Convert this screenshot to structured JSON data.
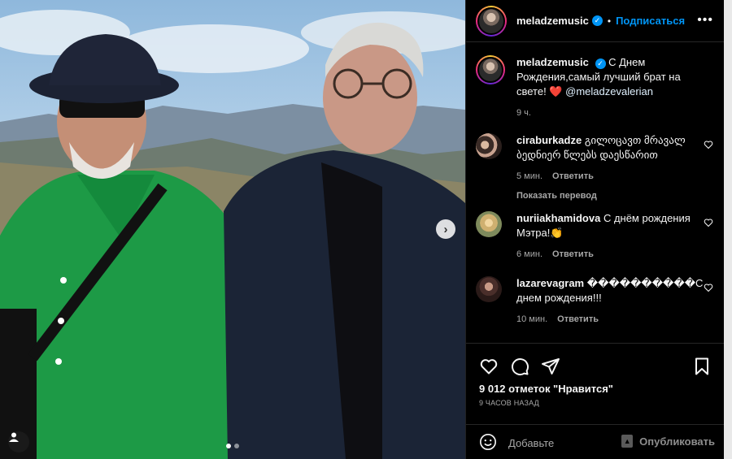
{
  "post": {
    "username": "meladzemusic",
    "follow_label": "Подписаться",
    "more_label": "•••",
    "next_label": "›"
  },
  "caption": {
    "username": "meladzemusic",
    "text": "С Днем Рождения,самый лучший брат на свете!",
    "emoji": "❤️",
    "mention": "@meladzevalerian",
    "time": "9 ч."
  },
  "comments": [
    {
      "username": "ciraburkadze",
      "text": "გილოცავთ მრავალ ბედნიერ წლებს დაესწარით",
      "time": "5 мин.",
      "reply_label": "Ответить",
      "translate_label": "Показать перевод"
    },
    {
      "username": "nuriiakhamidova",
      "text": "С днём рождения Мэтра!👏",
      "time": "6 мин.",
      "reply_label": "Ответить"
    },
    {
      "username": "lazarevagram",
      "text": "����������С днем рождения!!!",
      "time": "10 мин.",
      "reply_label": "Ответить"
    }
  ],
  "likes": "9 012 отметок \"Нравится\"",
  "posted_ago": "9 ЧАСОВ НАЗАД",
  "composer": {
    "placeholder": "Добавьте",
    "publish_label": "Опубликовать"
  },
  "colors": {
    "accent": "#0095f6",
    "background": "#000000",
    "secondary_text": "#a8a8a8",
    "heart": "#ed4956"
  },
  "icons": [
    "verified-icon",
    "heart-icon",
    "comment-icon",
    "share-icon",
    "bookmark-icon",
    "emoji-icon",
    "user-tag-icon",
    "chevron-right-icon"
  ],
  "carousel": {
    "slides": 2,
    "active": 1
  }
}
